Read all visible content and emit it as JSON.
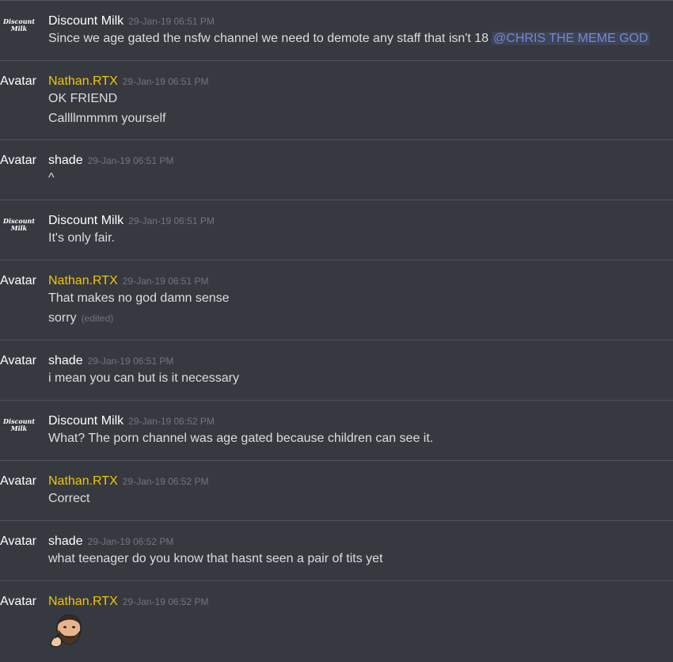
{
  "messages": [
    {
      "avatar_text": "Discount Milk",
      "author": "Discount Milk",
      "timestamp": "29-Jan-19 06:51 PM",
      "line1": "Since we age gated the nsfw channel we need to demote any staff that isn't 18",
      "mention": "@CHRIS THE MEME GOD"
    },
    {
      "avatar_text": "Avatar",
      "author": "Nathan.RTX",
      "timestamp": "29-Jan-19 06:51 PM",
      "line1": "OK FRIEND",
      "line2": "Callllmmmm yourself"
    },
    {
      "avatar_text": "Avatar",
      "author": "shade",
      "timestamp": "29-Jan-19 06:51 PM",
      "line1": "^"
    },
    {
      "avatar_text": "Discount Milk",
      "author": "Discount Milk",
      "timestamp": "29-Jan-19 06:51 PM",
      "line1": "It's only fair."
    },
    {
      "avatar_text": "Avatar",
      "author": "Nathan.RTX",
      "timestamp": "29-Jan-19 06:51 PM",
      "line1": "That makes no god damn sense",
      "line2": "sorry",
      "edited": "(edited)"
    },
    {
      "avatar_text": "Avatar",
      "author": "shade",
      "timestamp": "29-Jan-19 06:51 PM",
      "line1": "i mean you can but is it necessary"
    },
    {
      "avatar_text": "Discount Milk",
      "author": "Discount Milk",
      "timestamp": "29-Jan-19 06:52 PM",
      "line1": "What? The porn channel was age gated because children can see it."
    },
    {
      "avatar_text": "Avatar",
      "author": "Nathan.RTX",
      "timestamp": "29-Jan-19 06:52 PM",
      "line1": "Correct"
    },
    {
      "avatar_text": "Avatar",
      "author": "shade",
      "timestamp": "29-Jan-19 06:52 PM",
      "line1": "what teenager do you know that hasnt seen a pair of tits yet"
    },
    {
      "avatar_text": "Avatar",
      "author": "Nathan.RTX",
      "timestamp": "29-Jan-19 06:52 PM",
      "emoji": "bearded-face-emoji"
    }
  ],
  "logo": {
    "line1": "Discount",
    "line2": "Milk"
  },
  "colors": {
    "background": "#36393f",
    "divider": "#4f535a",
    "gold_role": "#f1c40f",
    "mention": "#7289da",
    "timestamp": "#72767d"
  }
}
